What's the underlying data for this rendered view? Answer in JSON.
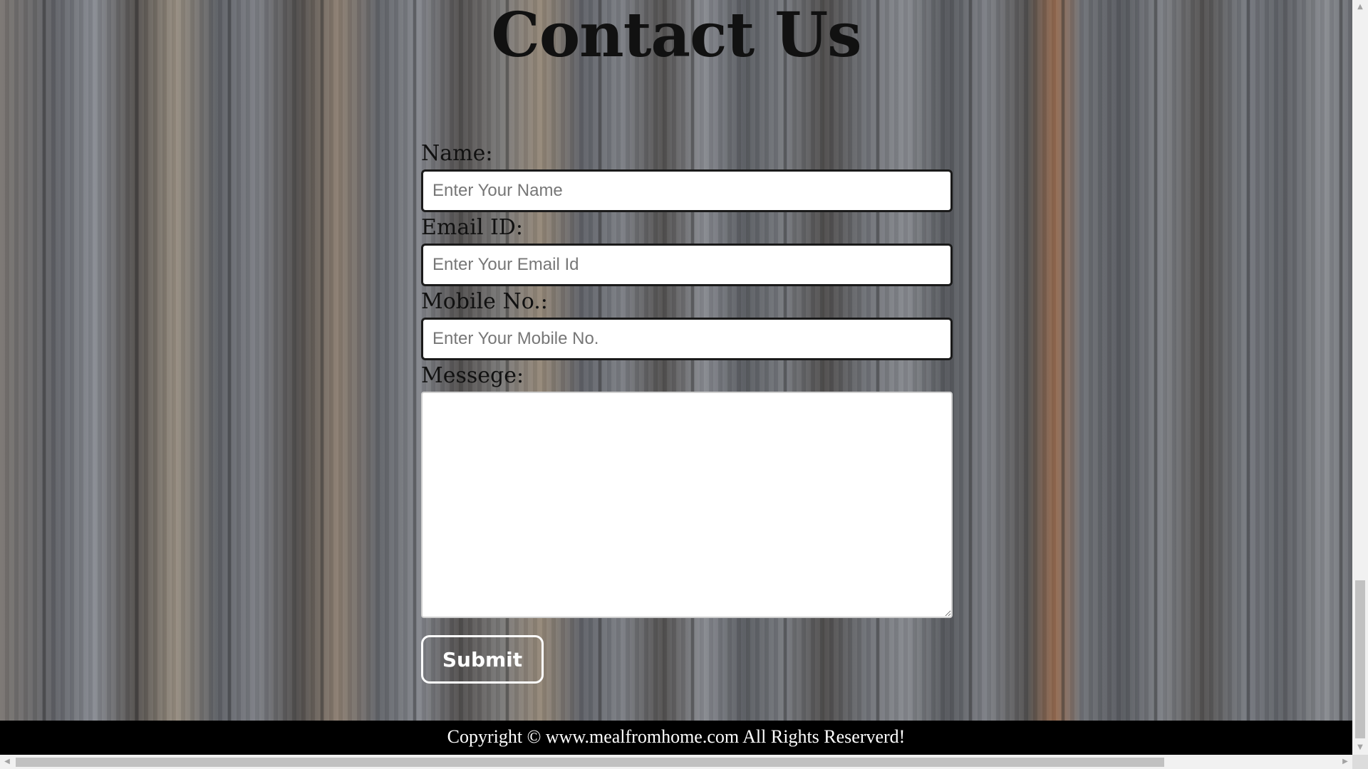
{
  "page": {
    "title": "Contact Us"
  },
  "form": {
    "name_label": "Name:",
    "name_placeholder": "Enter Your Name",
    "email_label": "Email ID:",
    "email_placeholder": "Enter Your Email Id",
    "mobile_label": "Mobile No.:",
    "mobile_placeholder": "Enter Your Mobile No.",
    "message_label": "Messege:",
    "message_value": "",
    "submit_label": "Submit"
  },
  "footer": {
    "copyright": "Copyright © www.mealfromhome.com All Rights Reserverd!"
  },
  "scrollbars": {
    "up_icon": "▲",
    "down_icon": "▼",
    "left_icon": "◀",
    "right_icon": "▶"
  },
  "colors": {
    "title": "#111111",
    "footer_bg": "#000000",
    "footer_text": "#ffffff",
    "button_border": "#ffffff"
  }
}
